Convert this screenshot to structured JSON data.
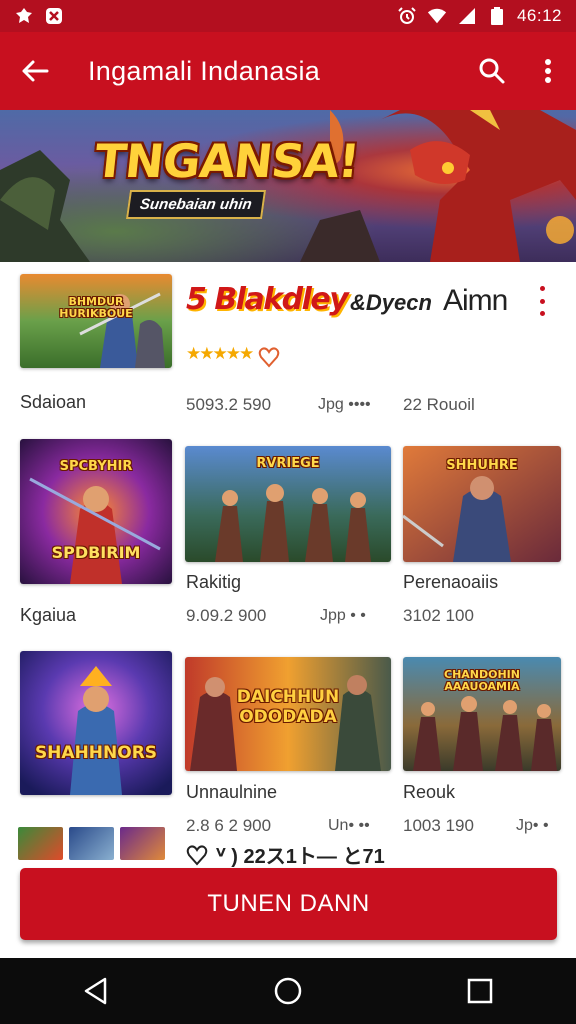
{
  "status_bar": {
    "time": "46:12",
    "icons": [
      "app-notification-icon",
      "app-shield-icon",
      "alarm-icon",
      "wifi-icon",
      "signal-icon",
      "battery-icon"
    ]
  },
  "app_bar": {
    "title": "Ingamali Indanasia",
    "icons": [
      "back-arrow-icon",
      "search-icon",
      "more-vert-icon"
    ]
  },
  "hero": {
    "title": "TNGANSA!",
    "subtitle": "Sunebaian uhin"
  },
  "featured": {
    "title": "5 Blakdley",
    "title_extra": "&Dyecn",
    "title_tail": "Aimn",
    "stars": "★★★★★",
    "label": "Sdaioan",
    "stat1": "5093.2 590",
    "stat2": "Jpg ••••",
    "stat3": "22 Rouoil",
    "tile_caption": "BHMDUR\nHURIKBOUE"
  },
  "grid": [
    {
      "caption": "SPCBYHIR",
      "label": "Kgaiua",
      "subcaption": "SPDBIRIM"
    },
    {
      "caption": "RVRIEGE",
      "label": "Rakitig",
      "stat1": "9.09.2 900",
      "stat2": "Jpp • •"
    },
    {
      "caption": "SHHUHRE",
      "label": "Perenaoaiis",
      "stat1": "3102 100"
    },
    {
      "caption": "SHAHHNORS",
      "label": ""
    },
    {
      "caption": "DAICHHUN ODODADA",
      "label": "Unnaulnine",
      "stat1": "2.8 6 2 900",
      "stat2": "Un• ••"
    },
    {
      "caption": "CHANDOHIN AAAUOAMIA",
      "label": "Reouk",
      "stat1": "1003 190",
      "stat2": "Jp• •"
    }
  ],
  "info_row": {
    "text": "ⱽ ) 22ス1ト— と71"
  },
  "cta": {
    "label": "TUNEN DANN"
  },
  "nav": {
    "icons": [
      "back-triangle-icon",
      "home-circle-icon",
      "recents-square-icon"
    ]
  },
  "colors": {
    "primary": "#c8101f",
    "status": "#b30f1f",
    "star": "#f5a800"
  }
}
